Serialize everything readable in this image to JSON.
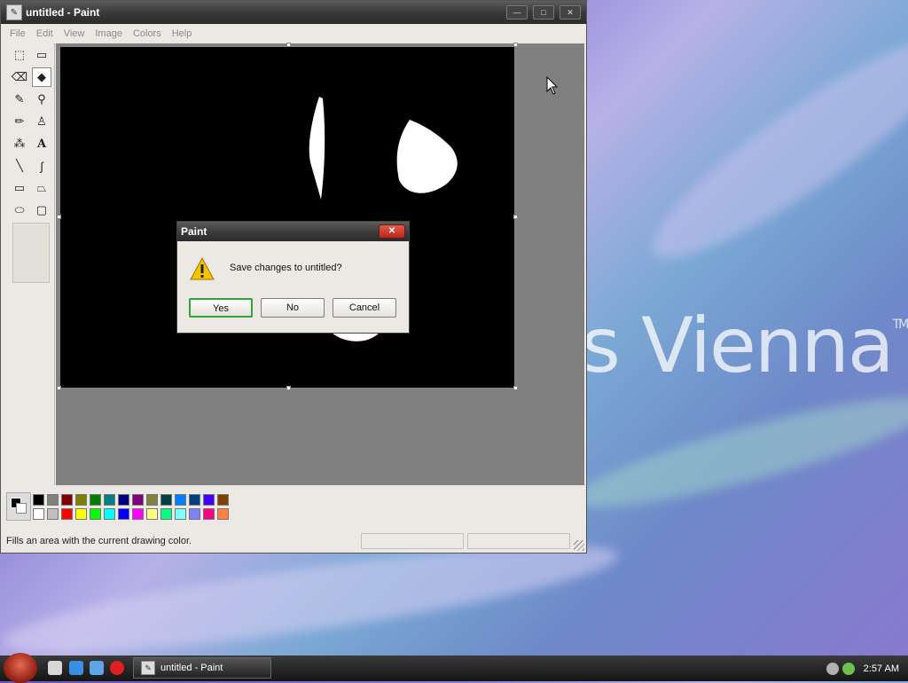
{
  "desktop": {
    "brand_text": "s Vienna",
    "trademark": "TM"
  },
  "paint": {
    "window_title": "untitled - Paint",
    "title_buttons": {
      "minimize": "—",
      "maximize": "□",
      "close": "✕"
    },
    "menu": [
      {
        "label": "File",
        "key": "F"
      },
      {
        "label": "Edit",
        "key": "E"
      },
      {
        "label": "View",
        "key": "V"
      },
      {
        "label": "Image",
        "key": "I"
      },
      {
        "label": "Colors",
        "key": "C"
      },
      {
        "label": "Help",
        "key": "H"
      }
    ],
    "tools": [
      {
        "name": "free-select-icon",
        "glyph": "⬚"
      },
      {
        "name": "rect-select-icon",
        "glyph": "▭"
      },
      {
        "name": "eraser-icon",
        "glyph": "⌫"
      },
      {
        "name": "fill-bucket-icon",
        "glyph": "◆"
      },
      {
        "name": "color-picker-icon",
        "glyph": "✎"
      },
      {
        "name": "magnifier-icon",
        "glyph": "⚲"
      },
      {
        "name": "pencil-icon",
        "glyph": "✏"
      },
      {
        "name": "brush-icon",
        "glyph": "♙"
      },
      {
        "name": "airbrush-icon",
        "glyph": "⁂"
      },
      {
        "name": "text-icon",
        "glyph": "A"
      },
      {
        "name": "line-icon",
        "glyph": "╲"
      },
      {
        "name": "curve-icon",
        "glyph": "∫"
      },
      {
        "name": "rectangle-icon",
        "glyph": "▭"
      },
      {
        "name": "polygon-icon",
        "glyph": "⏢"
      },
      {
        "name": "ellipse-icon",
        "glyph": "⬭"
      },
      {
        "name": "rounded-rect-icon",
        "glyph": "▢"
      }
    ],
    "selected_tool": "fill-bucket-icon",
    "colors": {
      "foreground": "#000000",
      "background": "#ffffff",
      "palette_row1": [
        "#000000",
        "#808080",
        "#800000",
        "#808000",
        "#008000",
        "#008080",
        "#000080",
        "#800080",
        "#808040",
        "#004040",
        "#0080ff",
        "#004080",
        "#4000ff",
        "#804000"
      ],
      "palette_row2": [
        "#ffffff",
        "#c0c0c0",
        "#ff0000",
        "#ffff00",
        "#00ff00",
        "#00ffff",
        "#0000ff",
        "#ff00ff",
        "#ffff80",
        "#00ff80",
        "#80ffff",
        "#8080ff",
        "#ff0080",
        "#ff8040"
      ]
    },
    "status_text": "Fills an area with the current drawing color."
  },
  "dialog": {
    "title": "Paint",
    "close": "✕",
    "message": "Save changes to untitled?",
    "buttons": [
      {
        "label": "Yes",
        "default": true
      },
      {
        "label": "No",
        "default": false
      },
      {
        "label": "Cancel",
        "default": false
      }
    ]
  },
  "taskbar": {
    "task_label": "untitled - Paint",
    "clock": "2:57 AM"
  }
}
